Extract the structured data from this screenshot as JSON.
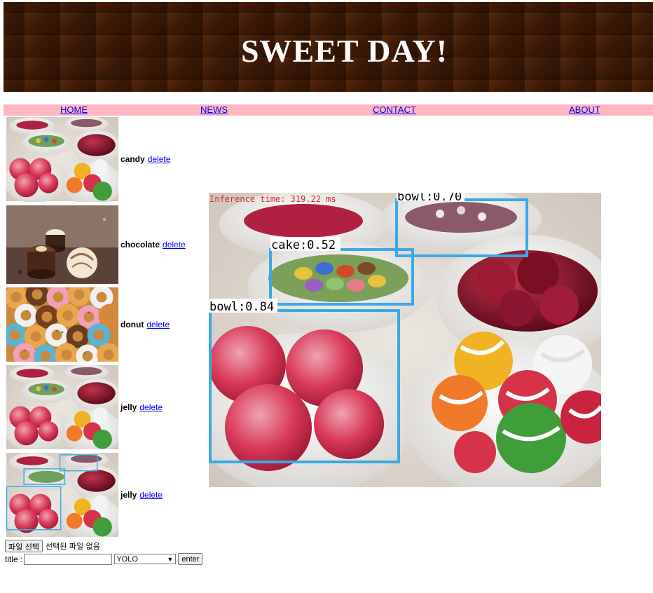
{
  "header": {
    "title": "SWEET DAY!"
  },
  "nav": {
    "home": "HOME",
    "news": "NEWS",
    "contact": "CONTACT",
    "about": "ABOUT"
  },
  "items": [
    {
      "label": "candy",
      "delete": "delete"
    },
    {
      "label": "chocolate",
      "delete": "delete"
    },
    {
      "label": "donut",
      "delete": "delete"
    },
    {
      "label": "jelly",
      "delete": "delete"
    },
    {
      "label": "jelly",
      "delete": "delete"
    }
  ],
  "detection": {
    "inference_text": "Inference time: 319.22 ms",
    "boxes": [
      {
        "label": "bowl:0.70"
      },
      {
        "label": "cake:0.52"
      },
      {
        "label": "bowl:0.84"
      }
    ],
    "box_color": "#3aa9e6",
    "inference_color": "#d0302a"
  },
  "form": {
    "file_button": "파일 선택",
    "file_status": "선택된 파일 없음",
    "title_label": "title :",
    "title_value": "",
    "model_selected": "YOLO",
    "enter_label": "enter"
  },
  "colors": {
    "nav_bg": "#ffb6c1",
    "banner_bg": "#3b1a06",
    "link": "#0000ee"
  }
}
